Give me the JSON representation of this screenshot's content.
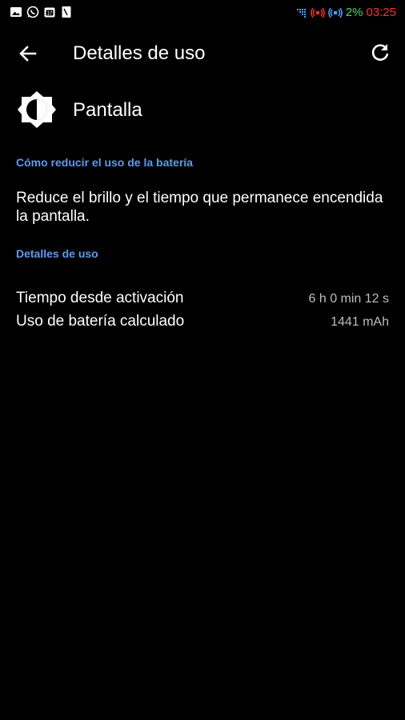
{
  "status_bar": {
    "left_icons": [
      "image-icon",
      "whatsapp-icon",
      "calendar-icon",
      "document-icon"
    ],
    "right_icons": [
      "data-signal-icon",
      "wifi-hotspot-red-icon",
      "wifi-hotspot-blue-icon"
    ],
    "battery_percent": "2%",
    "time": "03:25",
    "colors": {
      "battery": "#4cd964",
      "time": "#ff2d2d",
      "hotspot_red": "#ff2d2d",
      "hotspot_blue": "#4aa3ff",
      "signal": "#4aa3ff"
    }
  },
  "app_bar": {
    "title": "Detalles de uso",
    "back_icon": "arrow-back-icon",
    "refresh_icon": "refresh-icon"
  },
  "item": {
    "icon": "brightness-icon",
    "title": "Pantalla"
  },
  "sections": {
    "reduce_header": "Cómo reducir el uso de la batería",
    "reduce_tip": "Reduce el brillo y el tiempo que permanece encendida la pantalla.",
    "details_header": "Detalles de uso",
    "rows": [
      {
        "label": "Tiempo desde activación",
        "value": "6 h 0 min 12 s"
      },
      {
        "label": "Uso de batería calculado",
        "value": "1441 mAh"
      }
    ]
  },
  "colors": {
    "accent": "#5c9bf0",
    "background": "#000000",
    "text": "#ffffff",
    "secondary_text": "#bdbdbd"
  }
}
